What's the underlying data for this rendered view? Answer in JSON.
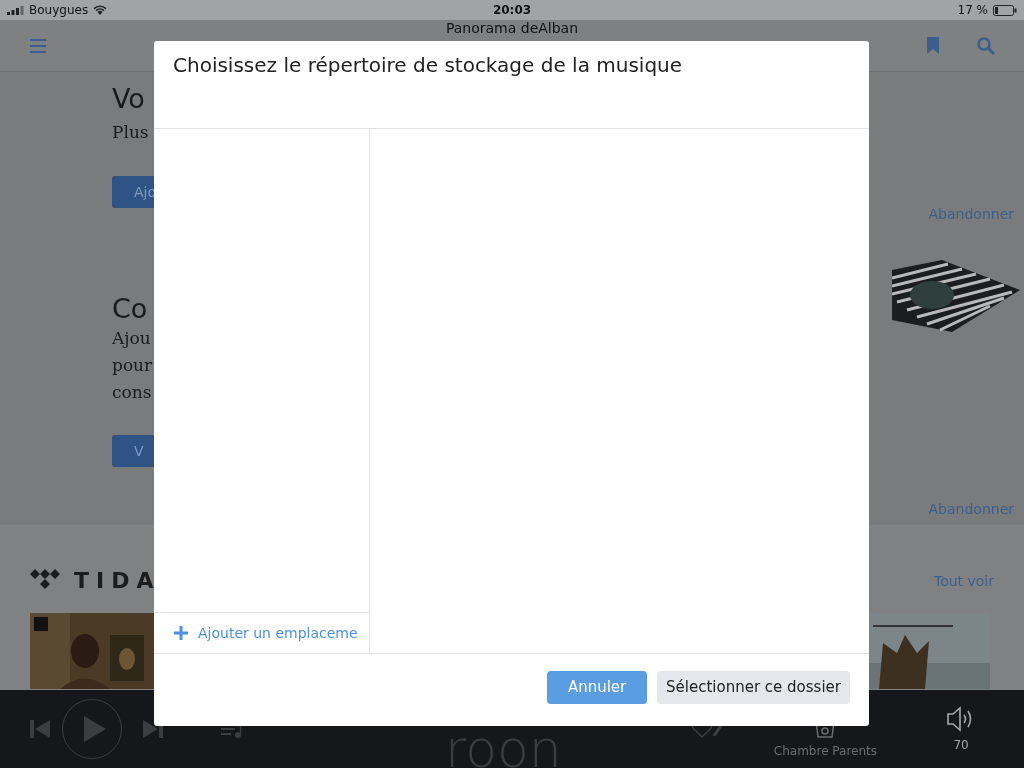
{
  "status_bar": {
    "carrier": "Bouygues",
    "time": "20:03",
    "battery": "17 %"
  },
  "header": {
    "title": "Panorama deAlban"
  },
  "sections": [
    {
      "heading": "Vo",
      "lines": [
        "Plus"
      ],
      "button": "Ajo",
      "dismiss": "Abandonner",
      "picture": false
    },
    {
      "heading": "Co",
      "lines": [
        "Ajou",
        "pour",
        "cons"
      ],
      "button": "V",
      "dismiss": "Abandonner",
      "picture": true
    }
  ],
  "tidal": {
    "title": "TIDA",
    "see_all": "Tout voir"
  },
  "player": {
    "logo": "roon",
    "zone": "Chambre Parents",
    "volume": "70"
  },
  "dialog": {
    "title": "Choisissez le répertoire de stockage de la musique",
    "add_location": "Ajouter un emplaceme",
    "buttons": [
      {
        "label": "Annuler",
        "kind": "primary"
      },
      {
        "label": "Sélectionner ce dossier",
        "kind": "secondary"
      }
    ]
  }
}
